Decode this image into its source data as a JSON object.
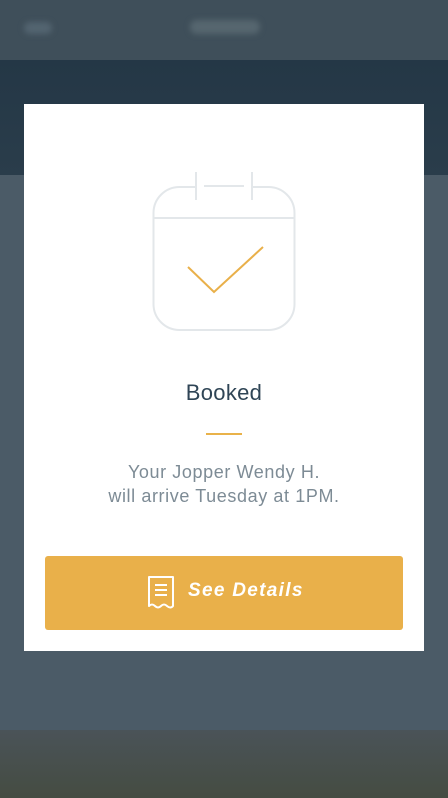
{
  "modal": {
    "title": "Booked",
    "message_line1": "Your Jopper Wendy H.",
    "message_line2": "will arrive Tuesday at 1PM.",
    "icon": "calendar-check-icon",
    "details_button": {
      "label": "See Details",
      "icon": "receipt-icon"
    }
  },
  "colors": {
    "accent": "#e9b04a",
    "title_text": "#2f4556",
    "body_text": "#7d8b95",
    "backdrop": "#4a5a66"
  }
}
